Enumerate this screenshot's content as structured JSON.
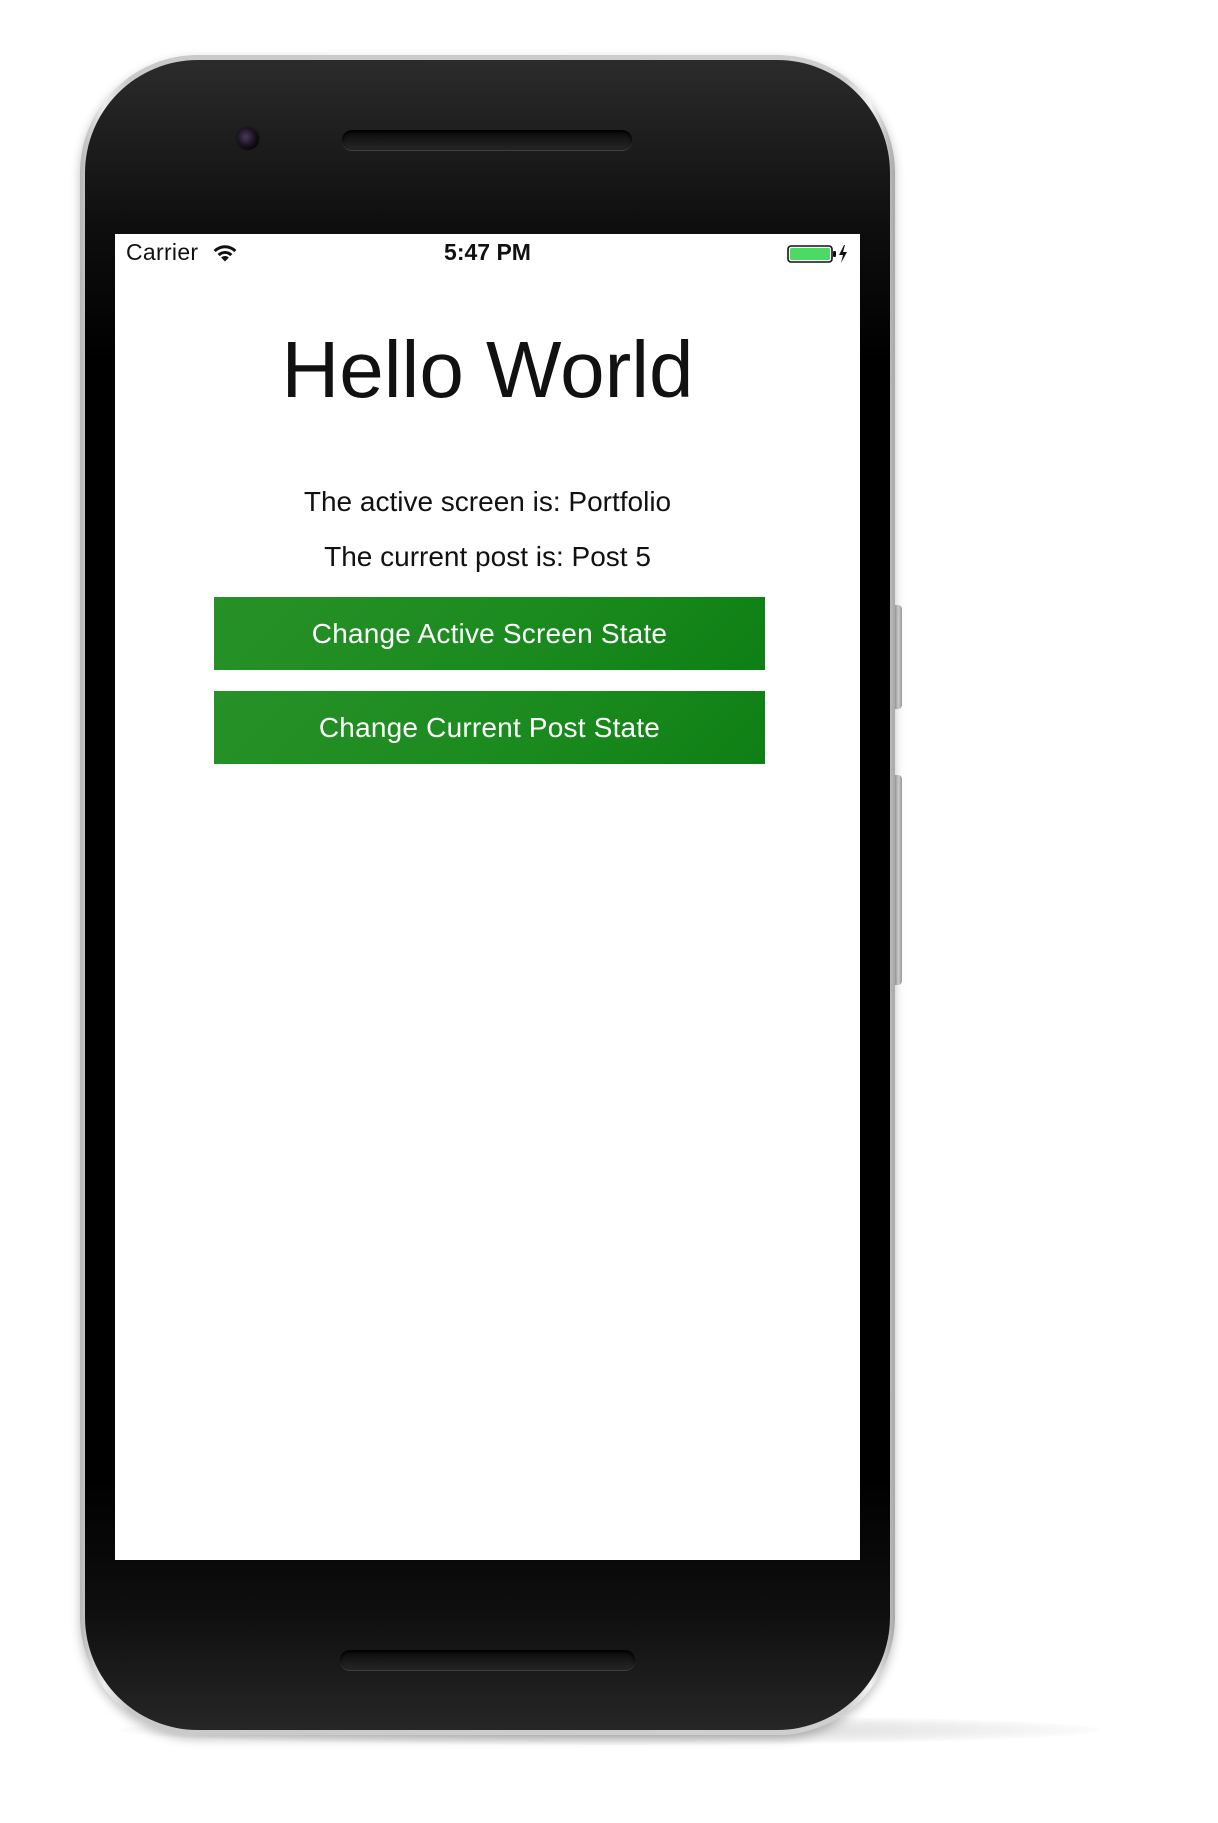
{
  "status_bar": {
    "carrier": "Carrier",
    "time": "5:47 PM",
    "battery_color": "#4cd964"
  },
  "main": {
    "title": "Hello World",
    "active_screen_text": "The active screen is: Portfolio",
    "current_post_text": "The current post is: Post 5",
    "change_active_screen_button": "Change Active Screen State",
    "change_current_post_button": "Change Current Post State"
  },
  "colors": {
    "button_green": "#1a8a1e",
    "button_text": "#ffffff",
    "screen_background": "#ffffff",
    "phone_body": "#000000"
  }
}
